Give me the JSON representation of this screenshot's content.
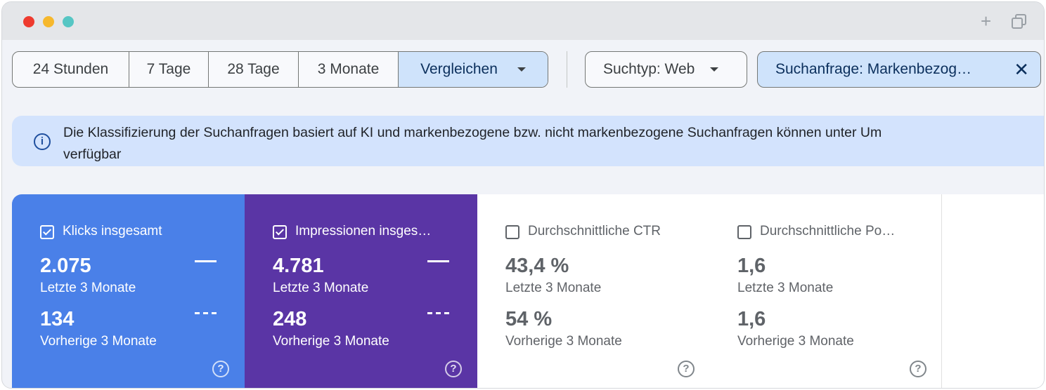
{
  "window": {
    "close_color": "#ee3b2f",
    "minimize_color": "#f6b82d",
    "maximize_color": "#56c6c4"
  },
  "titlebar": {
    "new_tab_icon": "+"
  },
  "toolbar": {
    "ranges": [
      "24 Stunden",
      "7 Tage",
      "28 Tage",
      "3 Monate"
    ],
    "compare_label": "Vergleichen",
    "search_type_label": "Suchtyp: Web",
    "query_filter_label": "Suchanfrage: Markenbezog…",
    "close_icon": "✕"
  },
  "banner": {
    "icon": "i",
    "text_line1": "Die Klassifizierung der Suchanfragen basiert auf KI und markenbezogene bzw. nicht markenbezogene Suchanfragen können unter Um",
    "text_line2": "verfügbar"
  },
  "metrics": [
    {
      "title": "Klicks insgesamt",
      "checked": true,
      "current_value": "2.075",
      "current_label": "Letzte 3 Monate",
      "previous_value": "134",
      "previous_label": "Vorherige 3 Monate",
      "color": "#4a80e8"
    },
    {
      "title": "Impressionen insges…",
      "checked": true,
      "current_value": "4.781",
      "current_label": "Letzte 3 Monate",
      "previous_value": "248",
      "previous_label": "Vorherige 3 Monate",
      "color": "#5a35a5"
    },
    {
      "title": "Durchschnittliche CTR",
      "checked": false,
      "current_value": "43,4 %",
      "current_label": "Letzte 3 Monate",
      "previous_value": "54 %",
      "previous_label": "Vorherige 3 Monate",
      "color": "#ffffff"
    },
    {
      "title": "Durchschnittliche Po…",
      "checked": false,
      "current_value": "1,6",
      "current_label": "Letzte 3 Monate",
      "previous_value": "1,6",
      "previous_label": "Vorherige 3 Monate",
      "color": "#ffffff"
    }
  ],
  "help_icon": "?"
}
